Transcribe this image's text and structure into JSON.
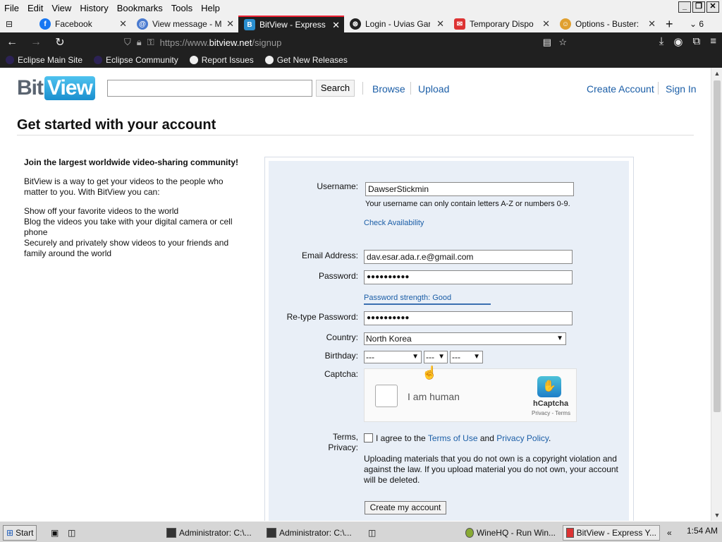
{
  "menu": {
    "items": [
      "File",
      "Edit",
      "View",
      "History",
      "Bookmarks",
      "Tools",
      "Help"
    ]
  },
  "window_buttons": [
    "minimize-icon",
    "restore-icon",
    "close-icon"
  ],
  "tabs": [
    {
      "label": "Facebook",
      "icon": "facebook-icon",
      "color": "#1877f2"
    },
    {
      "label": "View message - M",
      "icon": "at-icon",
      "color": "#4a7bd0"
    },
    {
      "label": "BitView - Express",
      "icon": "bitview-icon",
      "color": "#2a8fd0",
      "active": true
    },
    {
      "label": "Login - Uvias Gar",
      "icon": "uvias-icon",
      "color": "#222222"
    },
    {
      "label": "Temporary Dispo",
      "icon": "mail-icon",
      "color": "#d33"
    },
    {
      "label": "Options - Buster:",
      "icon": "buster-icon",
      "color": "#e0a030"
    }
  ],
  "tab_count": "6",
  "url": {
    "prefix": "https://www.",
    "host": "bitview.net",
    "path": "/signup"
  },
  "bookmarks": [
    "Eclipse Main Site",
    "Eclipse Community",
    "Report Issues",
    "Get New Releases"
  ],
  "site": {
    "logo_bit": "Bit",
    "logo_view": "View",
    "search_button": "Search",
    "nav": {
      "browse": "Browse",
      "upload": "Upload",
      "create": "Create Account",
      "signin": "Sign In"
    },
    "title": "Get started with your account"
  },
  "left": {
    "heading": "Join the largest worldwide video-sharing community!",
    "intro": "BitView is a way to get your videos to the people who matter to you. With BitView you can:",
    "b1": "Show off your favorite videos to the world",
    "b2": "Blog the videos you take with your digital camera or cell phone",
    "b3": "Securely and privately show videos to your friends and family around the world"
  },
  "form": {
    "username_label": "Username:",
    "username_value": "DawserStickmin",
    "username_hint": "Your username can only contain letters A-Z or numbers 0-9.",
    "check_availability": "Check Availability",
    "email_label": "Email Address:",
    "email_value": "dav.esar.ada.r.e@gmail.com",
    "password_label": "Password:",
    "password_value": "●●●●●●●●●●",
    "strength": "Password strength: Good",
    "retype_label": "Re-type Password:",
    "retype_value": "●●●●●●●●●●",
    "country_label": "Country:",
    "country_value": "North Korea",
    "birthday_label": "Birthday:",
    "birthday_month": "---",
    "birthday_day": "---",
    "birthday_year": "---",
    "captcha_label": "Captcha:",
    "captcha_text": "I am human",
    "captcha_brand": "hCaptcha",
    "captcha_fine": "Privacy - Terms",
    "terms_label_1": "Terms,",
    "terms_label_2": "Privacy:",
    "terms_pre": "I agree to the ",
    "terms_of_use": "Terms of Use",
    "terms_and": " and ",
    "privacy_policy": "Privacy Policy",
    "terms_post": ".",
    "warning": "Uploading materials that you do not own is a copyright violation and against the law. If you upload material you do not own, your account will be deleted.",
    "create_button": "Create my account"
  },
  "taskbar": {
    "start": "Start",
    "items": [
      "Administrator: C:\\...",
      "Administrator: C:\\...",
      "WineHQ - Run Win...",
      "BitView - Express Y..."
    ],
    "clock": "1:54 AM"
  }
}
